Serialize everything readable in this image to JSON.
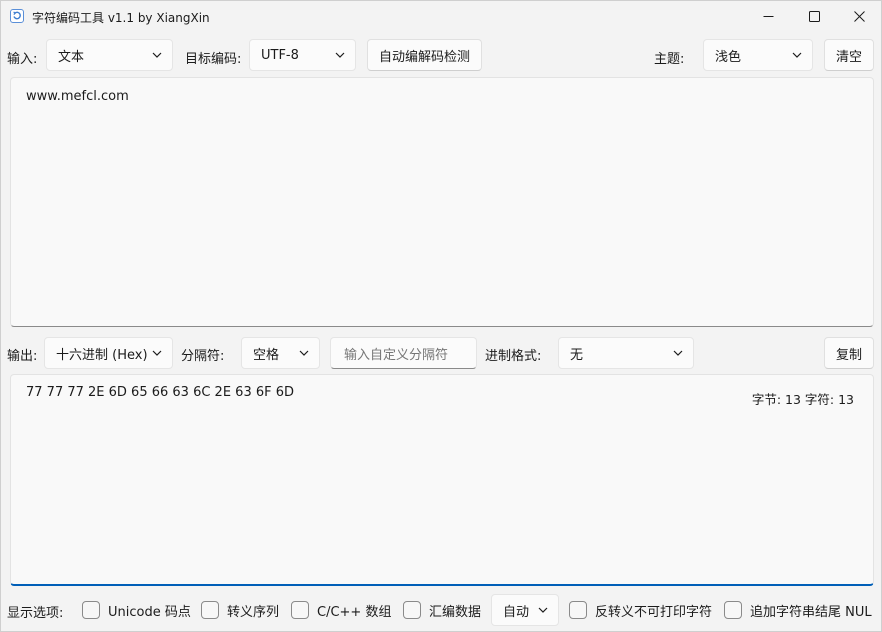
{
  "window": {
    "title": "字符编码工具 v1.1 by XiangXin"
  },
  "toolbar": {
    "input_label": "输入:",
    "input_mode": "文本",
    "target_encoding_label": "目标编码:",
    "target_encoding": "UTF-8",
    "auto_detect_button": "自动编解码检测",
    "theme_label": "主题:",
    "theme": "浅色",
    "clear_button": "清空"
  },
  "input_area": {
    "text": "www.mefcl.com"
  },
  "output_bar": {
    "output_label": "输出:",
    "output_format": "十六进制 (Hex)",
    "separator_label": "分隔符:",
    "separator": "空格",
    "custom_separator_placeholder": "输入自定义分隔符",
    "radix_format_label": "进制格式:",
    "radix_format": "无",
    "copy_button": "复制"
  },
  "output_area": {
    "text": "77 77 77 2E 6D 65 66 63 6C 2E 63 6F 6D",
    "stats": "字节: 13  字符: 13"
  },
  "display_options": {
    "label": "显示选项:",
    "unicode_codepoints": "Unicode 码点",
    "escape_sequence": "转义序列",
    "c_array": "C/C++ 数组",
    "asm_data": "汇编数据",
    "asm_mode": "自动",
    "unescape_nonprintable": "反转义不可打印字符",
    "append_nul": "追加字符串结尾 NUL"
  },
  "colors": {
    "accent": "#005fb8",
    "background": "#f3f3f3"
  }
}
